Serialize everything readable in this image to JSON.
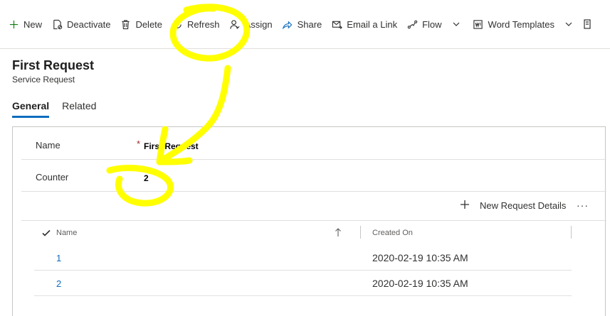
{
  "command_bar": {
    "items": [
      {
        "label": "New",
        "icon": "plus-icon"
      },
      {
        "label": "Deactivate",
        "icon": "deactivate-icon"
      },
      {
        "label": "Delete",
        "icon": "trash-icon"
      },
      {
        "label": "Refresh",
        "icon": "refresh-icon"
      },
      {
        "label": "Assign",
        "icon": "person-icon"
      },
      {
        "label": "Share",
        "icon": "share-icon"
      },
      {
        "label": "Email a Link",
        "icon": "email-icon"
      },
      {
        "label": "Flow",
        "icon": "flow-icon"
      },
      {
        "label": "Word Templates",
        "icon": "word-icon"
      }
    ]
  },
  "record": {
    "title": "First Request",
    "entity": "Service Request"
  },
  "tabs": [
    {
      "label": "General",
      "active": true
    },
    {
      "label": "Related",
      "active": false
    }
  ],
  "form": {
    "name_label": "Name",
    "name_required": "*",
    "name_value": "First Request",
    "counter_label": "Counter",
    "counter_value": "2"
  },
  "subgrid": {
    "new_button_label": "New Request Details",
    "more_label": "···",
    "columns": {
      "name": "Name",
      "created_on": "Created On"
    },
    "rows": [
      {
        "name": "1",
        "created_on": "2020-02-19 10:35 AM"
      },
      {
        "name": "2",
        "created_on": "2020-02-19 10:35 AM"
      }
    ]
  },
  "colors": {
    "accent": "#0f6cbd",
    "annotation": "#ffff00",
    "required": "#a4262c"
  }
}
